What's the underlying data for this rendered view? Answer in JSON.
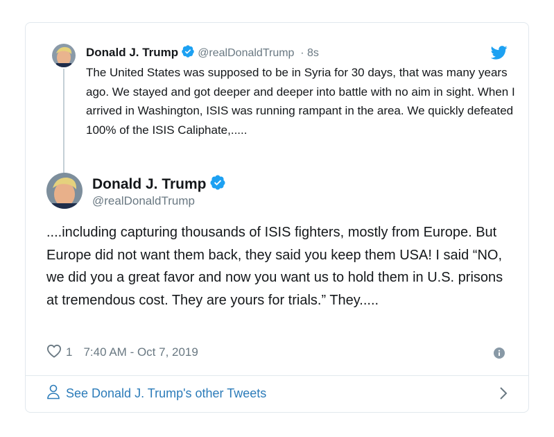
{
  "parent_tweet": {
    "name": "Donald J. Trump",
    "handle": "@realDonaldTrump",
    "time": "· 8s",
    "text": "The United States was supposed to be in Syria for 30 days, that was many years ago. We stayed and got deeper and deeper into battle with no aim in sight. When I arrived in Washington, ISIS was running rampant in the area. We quickly defeated 100% of the ISIS Caliphate,....."
  },
  "main_tweet": {
    "name": "Donald J. Trump",
    "handle": "@realDonaldTrump",
    "text": "....including capturing thousands of ISIS fighters, mostly from Europe. But Europe did not want them back, they said you keep them USA! I said “NO, we did you a great favor and now you want us to hold them in U.S. prisons at tremendous cost. They are yours for trials.” They.....",
    "likes": "1",
    "timestamp": "7:40 AM - Oct 7, 2019"
  },
  "footer": {
    "label": "See Donald J. Trump's other Tweets"
  },
  "icons": {
    "verified": "verified-badge-icon",
    "bird": "twitter-bird-icon",
    "heart": "heart-icon",
    "info": "info-icon",
    "person": "person-icon",
    "chevron": "chevron-right-icon"
  },
  "colors": {
    "verified_blue": "#1da1f2",
    "link_blue": "#2b7bb9",
    "secondary_text": "#697882",
    "border": "#e1e8ed"
  }
}
